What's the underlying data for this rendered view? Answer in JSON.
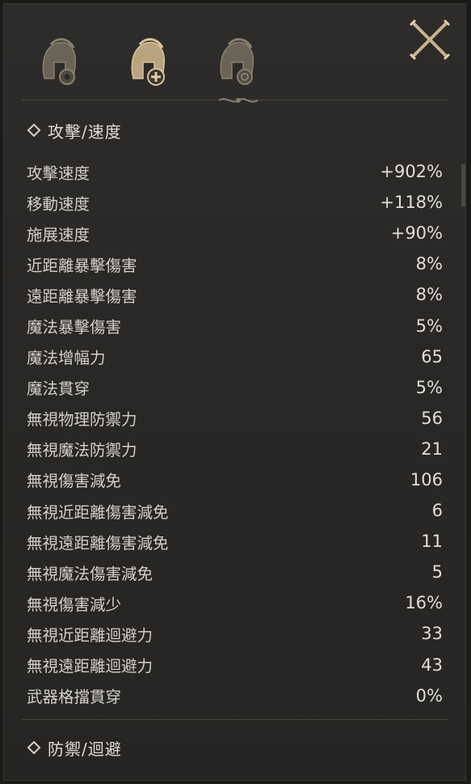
{
  "tabs": [
    {
      "icon": "helmet-gear-icon",
      "active": false
    },
    {
      "icon": "helmet-plus-icon",
      "active": true
    },
    {
      "icon": "helmet-target-icon",
      "active": false
    }
  ],
  "close_icon": "crossed-swords-close-icon",
  "sections": [
    {
      "title": "攻擊/速度",
      "stats": [
        {
          "label": "攻擊速度",
          "value": "+902%"
        },
        {
          "label": "移動速度",
          "value": "+118%"
        },
        {
          "label": "施展速度",
          "value": "+90%"
        },
        {
          "label": "近距離暴擊傷害",
          "value": "8%"
        },
        {
          "label": "遠距離暴擊傷害",
          "value": "8%"
        },
        {
          "label": "魔法暴擊傷害",
          "value": "5%"
        },
        {
          "label": "魔法增幅力",
          "value": "65"
        },
        {
          "label": "魔法貫穿",
          "value": "5%"
        },
        {
          "label": "無視物理防禦力",
          "value": "56"
        },
        {
          "label": "無視魔法防禦力",
          "value": "21"
        },
        {
          "label": "無視傷害減免",
          "value": "106"
        },
        {
          "label": "無視近距離傷害減免",
          "value": "6"
        },
        {
          "label": "無視遠距離傷害減免",
          "value": "11"
        },
        {
          "label": "無視魔法傷害減免",
          "value": "5"
        },
        {
          "label": "無視傷害減少",
          "value": "16%"
        },
        {
          "label": "無視近距離迴避力",
          "value": "33"
        },
        {
          "label": "無視遠距離迴避力",
          "value": "43"
        },
        {
          "label": "武器格擋貫穿",
          "value": "0%"
        }
      ]
    },
    {
      "title": "防禦/迴避",
      "stats": []
    }
  ],
  "colors": {
    "accent_gold": "#c9b48a",
    "text": "#d4d0c7",
    "panel_bg": "#2b2a28"
  }
}
